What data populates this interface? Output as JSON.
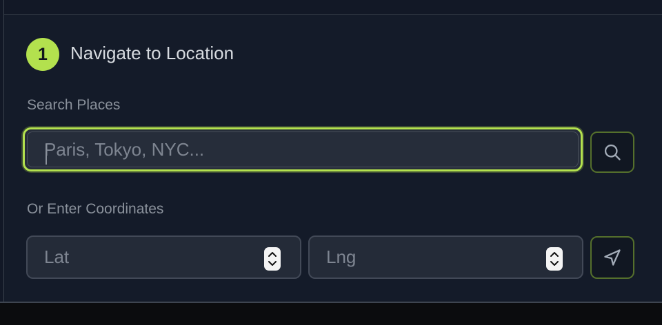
{
  "section": {
    "step_number": "1",
    "title": "Navigate to Location"
  },
  "search": {
    "label": "Search Places",
    "placeholder": "Paris, Tokyo, NYC...",
    "value": "",
    "button_icon": "search-icon"
  },
  "coordinates": {
    "label": "Or Enter Coordinates",
    "lat_placeholder": "Lat",
    "lng_placeholder": "Lng",
    "go_button_icon": "navigation-arrow-icon"
  },
  "colors": {
    "accent": "#b3e14e",
    "background": "#141b29",
    "field_background": "#242b38",
    "label_text": "#8a919b"
  }
}
